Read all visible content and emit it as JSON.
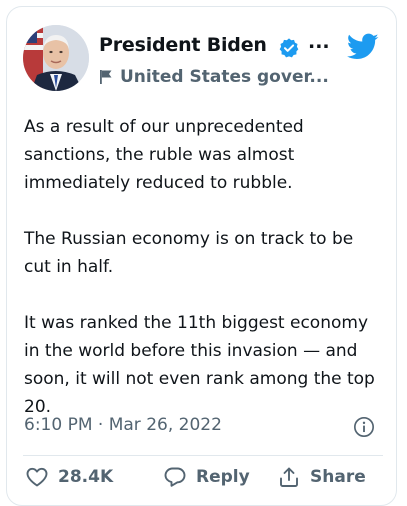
{
  "author": {
    "name": "President Biden",
    "handle": "United States gover...",
    "more": "..."
  },
  "tweet": {
    "text": "As a result of our unprecedented sanctions, the ruble was almost immediately reduced to rubble.\n\nThe Russian economy is on track to be cut in half.\n\nIt was ranked the 11th biggest economy in the world before this invasion — and soon, it will not even rank among the top 20.",
    "timestamp": "6:10 PM · Mar 26, 2022"
  },
  "actions": {
    "like_count": "28.4K",
    "reply_label": "Reply",
    "share_label": "Share"
  },
  "icons": {
    "verified": "verified-badge-icon",
    "brand": "twitter-bird-icon",
    "handle_label": "government-flag-icon",
    "info": "info-icon",
    "like": "heart-icon",
    "reply": "reply-bubble-icon",
    "share": "share-upload-icon"
  },
  "colors": {
    "brand_blue": "#1d9bf0",
    "text": "#0f1419",
    "secondary": "#536471",
    "border": "#e1e8ed"
  }
}
